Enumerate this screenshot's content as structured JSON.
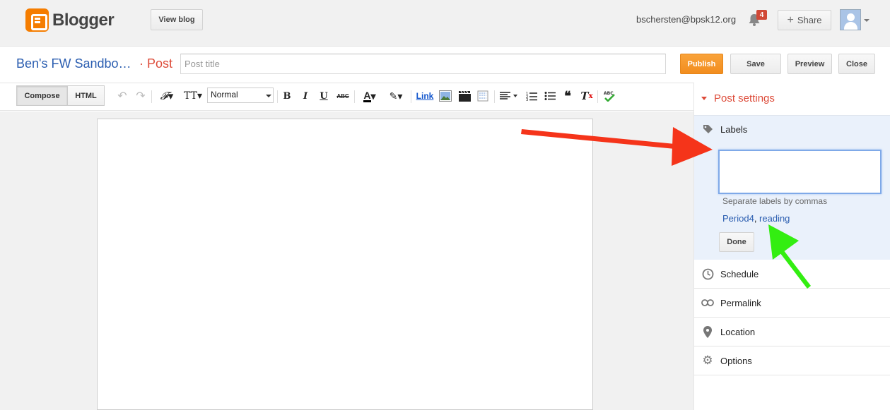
{
  "header": {
    "app_name": "Blogger",
    "view_blog_label": "View blog",
    "account_email": "bschersten@bpsk12.org",
    "notification_count": "4",
    "share_label": "Share"
  },
  "post": {
    "blog_name": "Ben's FW Sandbo…",
    "post_label": "· Post",
    "title_placeholder": "Post title",
    "title_value": ""
  },
  "actions": {
    "publish": "Publish",
    "save": "Save",
    "preview": "Preview",
    "close": "Close"
  },
  "toolbar": {
    "compose_tab": "Compose",
    "html_tab": "HTML",
    "paragraph_style": "Normal",
    "link_label": "Link",
    "icons": [
      "undo-icon",
      "redo-icon",
      "font-family-icon",
      "font-size-icon",
      "bold-icon",
      "italic-icon",
      "underline-icon",
      "strikethrough-icon",
      "text-color-icon",
      "highlight-color-icon",
      "link",
      "insert-image-icon",
      "insert-video-icon",
      "insert-jump-break-icon",
      "alignment-icon",
      "numbered-list-icon",
      "bulleted-list-icon",
      "quote-icon",
      "remove-formatting-icon",
      "spellcheck-icon"
    ]
  },
  "sidebar": {
    "title": "Post settings",
    "labels": {
      "heading": "Labels",
      "input_value": "",
      "hint": "Separate labels by commas",
      "existing": [
        "Period4",
        "reading"
      ],
      "done_label": "Done"
    },
    "items": [
      {
        "label": "Schedule",
        "icon": "clock-icon"
      },
      {
        "label": "Permalink",
        "icon": "link-icon"
      },
      {
        "label": "Location",
        "icon": "map-pin-icon"
      },
      {
        "label": "Options",
        "icon": "gear-icon"
      }
    ]
  },
  "colors": {
    "accent_orange": "#f57d00",
    "publish_orange": "#f28d1e",
    "post_red": "#dd4b39",
    "link_blue": "#2a5db0",
    "annotation_red_arrow": "#f5341a",
    "annotation_green_arrow": "#33ee11"
  }
}
